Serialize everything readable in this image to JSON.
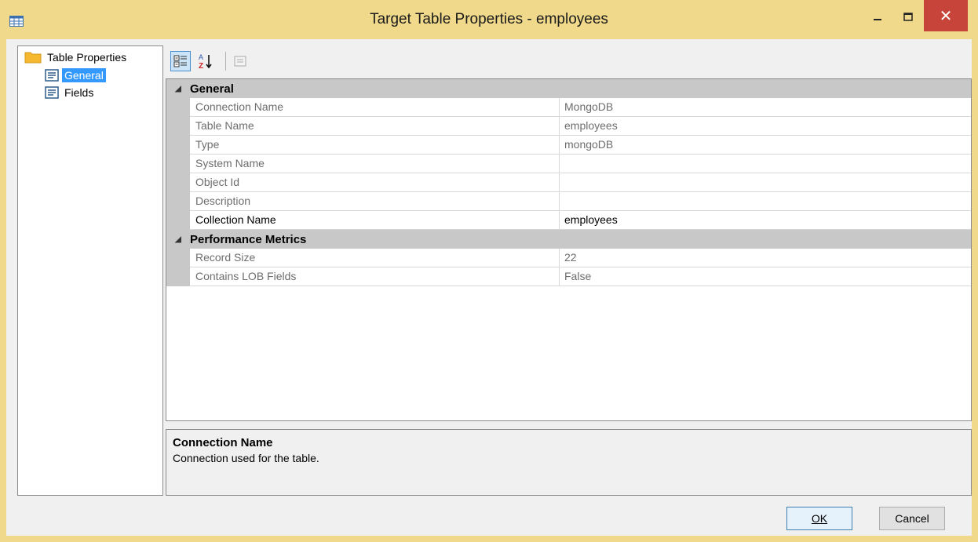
{
  "window": {
    "title": "Target Table Properties - employees",
    "close_glyph": "✕",
    "accent_color": "#f0d98a",
    "close_color": "#c7443b"
  },
  "tree": {
    "root_label": "Table Properties",
    "items": [
      {
        "label": "General",
        "icon": "page-icon",
        "selected": true
      },
      {
        "label": "Fields",
        "icon": "page-icon",
        "selected": false
      }
    ]
  },
  "toolbar": {
    "categorized_icon": "categorized-icon",
    "alphabetical_icon": "sort-az-icon",
    "property_pages_icon": "property-pages-icon"
  },
  "grid": {
    "categories": [
      {
        "name": "General",
        "rows": [
          {
            "name": "Connection Name",
            "value": "MongoDB"
          },
          {
            "name": "Table Name",
            "value": "employees"
          },
          {
            "name": "Type",
            "value": "mongoDB"
          },
          {
            "name": "System Name",
            "value": ""
          },
          {
            "name": "Object Id",
            "value": ""
          },
          {
            "name": "Description",
            "value": ""
          },
          {
            "name": "Collection Name",
            "value": "employees"
          }
        ]
      },
      {
        "name": "Performance Metrics",
        "rows": [
          {
            "name": "Record Size",
            "value": "22"
          },
          {
            "name": "Contains LOB Fields",
            "value": "False"
          }
        ]
      }
    ]
  },
  "description": {
    "title": "Connection Name",
    "text": "Connection used for the table."
  },
  "buttons": {
    "ok_label": "OK",
    "cancel_label": "Cancel"
  }
}
